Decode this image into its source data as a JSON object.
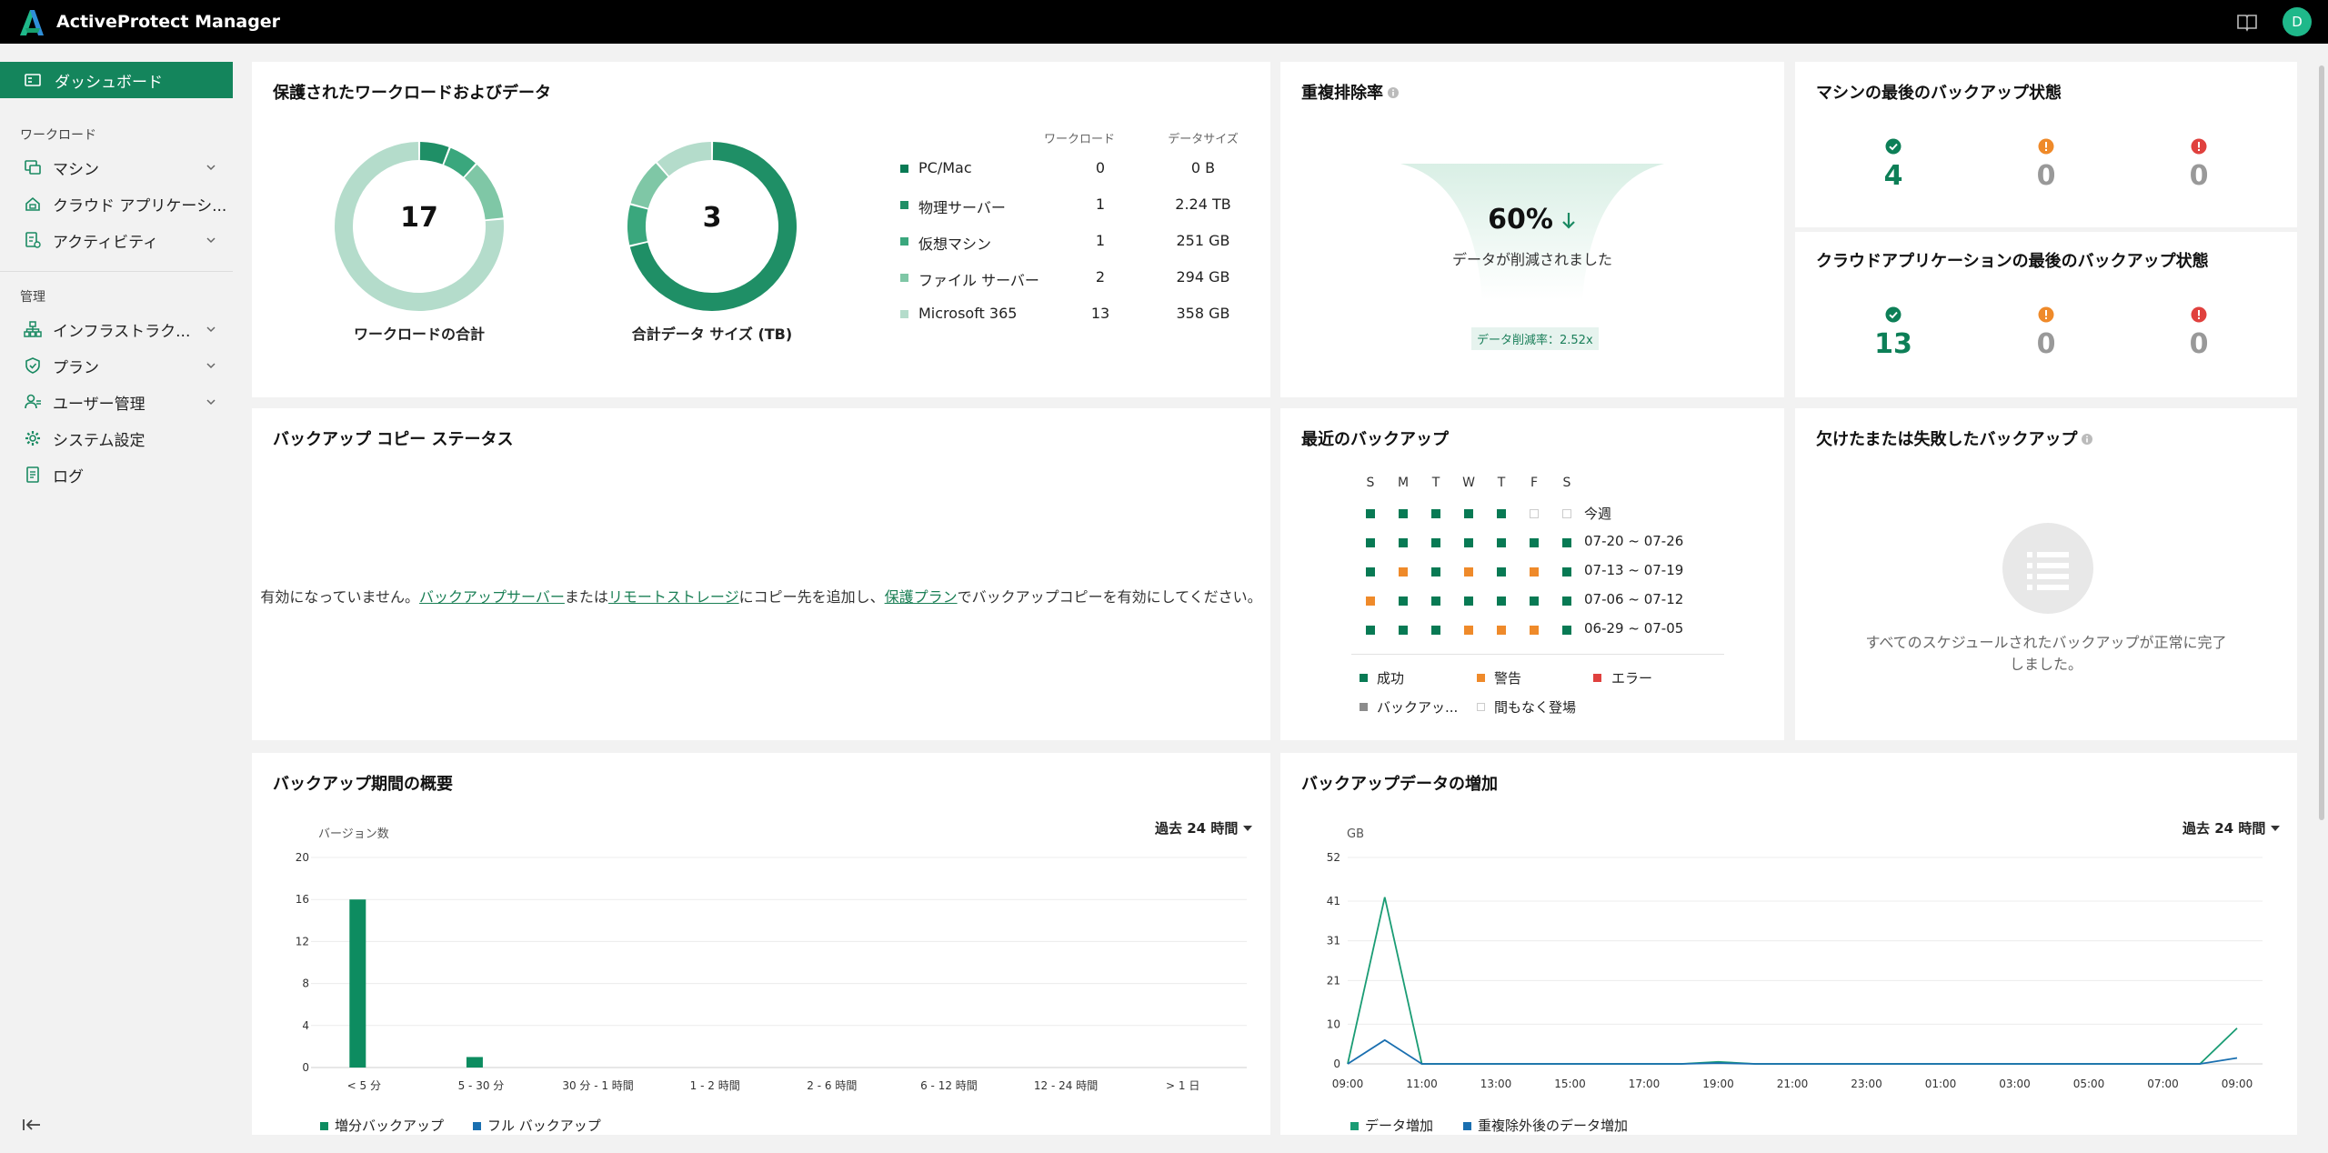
{
  "app": {
    "title": "ActiveProtect Manager",
    "user_initial": "D"
  },
  "colors": {
    "dark_green": "#087a54",
    "mid_green": "#3aa77d",
    "light_green": "#7fc7a6",
    "pale_green": "#b4dccb",
    "orange": "#ef8a2a",
    "red": "#e0413e",
    "blue": "#1a6fb0",
    "accent": "#14855c"
  },
  "sidebar": {
    "active": "ダッシュボード",
    "section_workload": "ワークロード",
    "items_workload": [
      {
        "label": "マシン",
        "icon": "machine-icon",
        "chevron": true
      },
      {
        "label": "クラウド アプリケーシ...",
        "icon": "cloud-app-icon",
        "chevron": false
      },
      {
        "label": "アクティビティ",
        "icon": "activity-icon",
        "chevron": true
      }
    ],
    "section_admin": "管理",
    "items_admin": [
      {
        "label": "インフラストラク...",
        "icon": "infrastructure-icon",
        "chevron": true
      },
      {
        "label": "プラン",
        "icon": "plan-icon",
        "chevron": true
      },
      {
        "label": "ユーザー管理",
        "icon": "user-icon",
        "chevron": true
      },
      {
        "label": "システム設定",
        "icon": "gear-icon",
        "chevron": false
      },
      {
        "label": "ログ",
        "icon": "log-icon",
        "chevron": false
      }
    ]
  },
  "protected": {
    "title": "保護されたワークロードおよびデータ",
    "total_workloads": "17",
    "total_workloads_label": "ワークロードの合計",
    "total_data": "3",
    "total_data_label": "合計データ サイズ (TB)",
    "col_workload": "ワークロード",
    "col_size": "データサイズ",
    "rows": [
      {
        "name": "PC/Mac",
        "count": "0",
        "size": "0 B",
        "count_num": 0,
        "size_tb": 0,
        "color": "#087a54"
      },
      {
        "name": "物理サーバー",
        "count": "1",
        "size": "2.24 TB",
        "count_num": 1,
        "size_tb": 2.24,
        "color": "#1f8f66"
      },
      {
        "name": "仮想マシン",
        "count": "1",
        "size": "251 GB",
        "count_num": 1,
        "size_tb": 0.251,
        "color": "#3aa77d"
      },
      {
        "name": "ファイル サーバー",
        "count": "2",
        "size": "294 GB",
        "count_num": 2,
        "size_tb": 0.294,
        "color": "#7fc7a6"
      },
      {
        "name": "Microsoft 365",
        "count": "13",
        "size": "358 GB",
        "count_num": 13,
        "size_tb": 0.358,
        "color": "#b4dccb"
      }
    ]
  },
  "dedup": {
    "title": "重複排除率",
    "percent": "60%",
    "subtitle": "データが削減されました",
    "ratio_label": "データ削減率：2.52x"
  },
  "machine_status": {
    "title": "マシンの最後のバックアップ状態",
    "success": "4",
    "warning": "0",
    "error": "0"
  },
  "cloud_status": {
    "title": "クラウドアプリケーションの最後のバックアップ状態",
    "success": "13",
    "warning": "0",
    "error": "0"
  },
  "copy_status": {
    "title": "バックアップ コピー ステータス",
    "msg_1": "有効になっていません。",
    "link_1": "バックアップサーバー",
    "msg_2": "または",
    "link_2": "リモートストレージ",
    "msg_3": "にコピー先を追加し、",
    "link_3": "保護プラン",
    "msg_4": "でバックアップコピーを有効にしてください。"
  },
  "recent": {
    "title": "最近のバックアップ",
    "days": [
      "S",
      "M",
      "T",
      "W",
      "T",
      "F",
      "S"
    ],
    "weeks": [
      {
        "label": "今週",
        "cells": [
          "s",
          "s",
          "s",
          "s",
          "s",
          "u",
          "u"
        ]
      },
      {
        "label": "07-20 ~ 07-26",
        "cells": [
          "s",
          "s",
          "s",
          "s",
          "s",
          "s",
          "s"
        ]
      },
      {
        "label": "07-13 ~ 07-19",
        "cells": [
          "s",
          "w",
          "s",
          "w",
          "s",
          "w",
          "s"
        ]
      },
      {
        "label": "07-06 ~ 07-12",
        "cells": [
          "w",
          "s",
          "s",
          "s",
          "s",
          "s",
          "s"
        ]
      },
      {
        "label": "06-29 ~ 07-05",
        "cells": [
          "s",
          "s",
          "s",
          "w",
          "w",
          "w",
          "s"
        ]
      }
    ],
    "legend": {
      "success": "成功",
      "warning": "警告",
      "error": "エラー",
      "backup": "バックアッ...",
      "upcoming": "間もなく登場"
    }
  },
  "missed": {
    "title": "欠けたまたは失敗したバックアップ",
    "message": "すべてのスケジュールされたバックアップが正常に完了しました。"
  },
  "duration": {
    "title": "バックアップ期間の概要",
    "range": "過去 24 時間",
    "legend_incremental": "増分バックアップ",
    "legend_full": "フル バックアップ"
  },
  "growth": {
    "title": "バックアップデータの増加",
    "range": "過去 24 時間",
    "legend_growth": "データ増加",
    "legend_after_dedup": "重複除外後のデータ増加"
  },
  "chart_data": [
    {
      "type": "bar",
      "ylabel": "バージョン数",
      "categories": [
        "< 5 分",
        "5 - 30 分",
        "30 分 - 1 時間",
        "1 - 2 時間",
        "2 - 6 時間",
        "6 - 12 時間",
        "12 - 24 時間",
        "> 1 日"
      ],
      "yticks": [
        0,
        4,
        8,
        12,
        16,
        20
      ],
      "ylim": [
        0,
        20
      ],
      "series": [
        {
          "name": "増分バックアップ",
          "values": [
            16,
            1,
            0,
            0,
            0,
            0,
            0,
            0
          ],
          "color": "#0d8c60"
        },
        {
          "name": "フル バックアップ",
          "values": [
            0,
            0,
            0,
            0,
            0,
            0,
            0,
            0
          ],
          "color": "#1a6fb0"
        }
      ],
      "grid": true,
      "legend": "bottom-left"
    },
    {
      "type": "line",
      "ylabel": "GB",
      "x": [
        "09:00",
        "10:00",
        "11:00",
        "12:00",
        "13:00",
        "14:00",
        "15:00",
        "16:00",
        "17:00",
        "18:00",
        "19:00",
        "20:00",
        "21:00",
        "22:00",
        "23:00",
        "00:00",
        "01:00",
        "02:00",
        "03:00",
        "04:00",
        "05:00",
        "06:00",
        "07:00",
        "08:00",
        "09:00"
      ],
      "xticks": [
        "09:00",
        "11:00",
        "13:00",
        "15:00",
        "17:00",
        "19:00",
        "21:00",
        "23:00",
        "01:00",
        "03:00",
        "05:00",
        "07:00",
        "09:00"
      ],
      "yticks": [
        0,
        10,
        21,
        31,
        41,
        52
      ],
      "ylim": [
        0,
        52
      ],
      "series": [
        {
          "name": "データ増加",
          "values": [
            0,
            42,
            0,
            0,
            0,
            0,
            0,
            0,
            0,
            0,
            0.5,
            0,
            0,
            0,
            0,
            0,
            0,
            0,
            0,
            0,
            0,
            0,
            0,
            0,
            9
          ],
          "color": "#1a9c74"
        },
        {
          "name": "重複除外後のデータ増加",
          "values": [
            0,
            6,
            0,
            0,
            0,
            0,
            0,
            0,
            0,
            0,
            0.2,
            0,
            0,
            0,
            0,
            0,
            0,
            0,
            0,
            0,
            0,
            0,
            0,
            0,
            1.5
          ],
          "color": "#1a6fb0"
        }
      ],
      "grid": true,
      "legend": "bottom-left"
    }
  ]
}
